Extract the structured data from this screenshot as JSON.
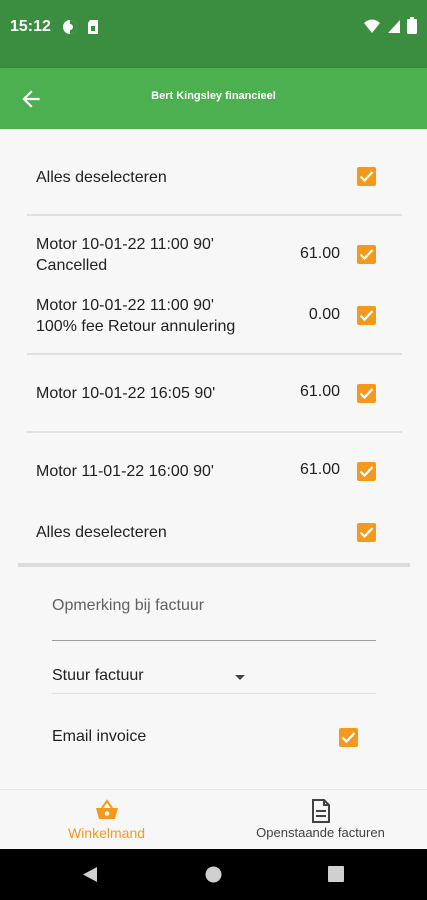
{
  "status_bar": {
    "time": "15:12"
  },
  "app_bar": {
    "title": "Bert Kingsley financieel"
  },
  "select_all_top": {
    "label": "Alles deselecteren"
  },
  "items": [
    {
      "line1": "Motor 10-01-22 11:00 90'",
      "line2": "Cancelled",
      "amount": "61.00"
    },
    {
      "line1": "Motor 10-01-22 11:00 90'",
      "line2": "100% fee Retour annulering",
      "amount": "0.00"
    },
    {
      "line1": "Motor 10-01-22 16:05 90'",
      "line2": "",
      "amount": "61.00"
    },
    {
      "line1": "Motor 11-01-22 16:00 90'",
      "line2": "",
      "amount": "61.00"
    }
  ],
  "select_all_bottom": {
    "label": "Alles deselecteren"
  },
  "remark": {
    "placeholder": "Opmerking bij factuur"
  },
  "send_invoice": {
    "value": "Stuur factuur"
  },
  "email_invoice": {
    "label": "Email invoice"
  },
  "bottom_nav": {
    "cart": "Winkelmand",
    "open_invoices": "Openstaande facturen"
  },
  "colors": {
    "primary": "#4caf50",
    "primary_dark": "#3b8d3f",
    "accent": "#f39a1e"
  }
}
